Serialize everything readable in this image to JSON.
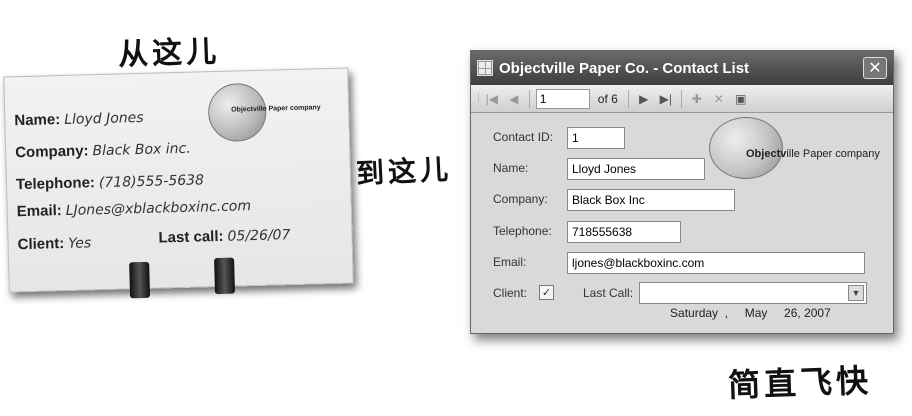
{
  "annotations": {
    "from_here": "从这儿",
    "to_here": "到这儿",
    "super_fast": "简直飞快"
  },
  "card": {
    "logo_text": "Objectville Paper company",
    "name_label": "Name:",
    "name_value": "Lloyd Jones",
    "company_label": "Company:",
    "company_value": "Black Box inc.",
    "phone_label": "Telephone:",
    "phone_value": "(718)555-5638",
    "email_label": "Email:",
    "email_value": "LJones@xblackboxinc.com",
    "client_label": "Client:",
    "client_value": "Yes",
    "lastcall_label": "Last call:",
    "lastcall_value": "05/26/07"
  },
  "window": {
    "title": "Objectville Paper Co. - Contact List",
    "close_glyph": "✕",
    "toolbar": {
      "position_value": "1",
      "of_count": "of 6"
    },
    "logo_text_bold": "Objectv",
    "logo_text_rest": "ille Paper company",
    "form": {
      "contact_id_label": "Contact ID:",
      "contact_id_value": "1",
      "name_label": "Name:",
      "name_value": "Lloyd Jones",
      "company_label": "Company:",
      "company_value": "Black Box Inc",
      "phone_label": "Telephone:",
      "phone_value": "718555638",
      "email_label": "Email:",
      "email_value": "ljones@blackboxinc.com",
      "client_label": "Client:",
      "client_checked": "✓",
      "lastcall_label": "Last Call:",
      "lastcall_value": "Saturday  ,     May     26, 2007"
    }
  },
  "colors": {
    "titlebar": "#4e4e4e",
    "window_bg": "#d9d9d9",
    "card_bg": "#ececec"
  }
}
